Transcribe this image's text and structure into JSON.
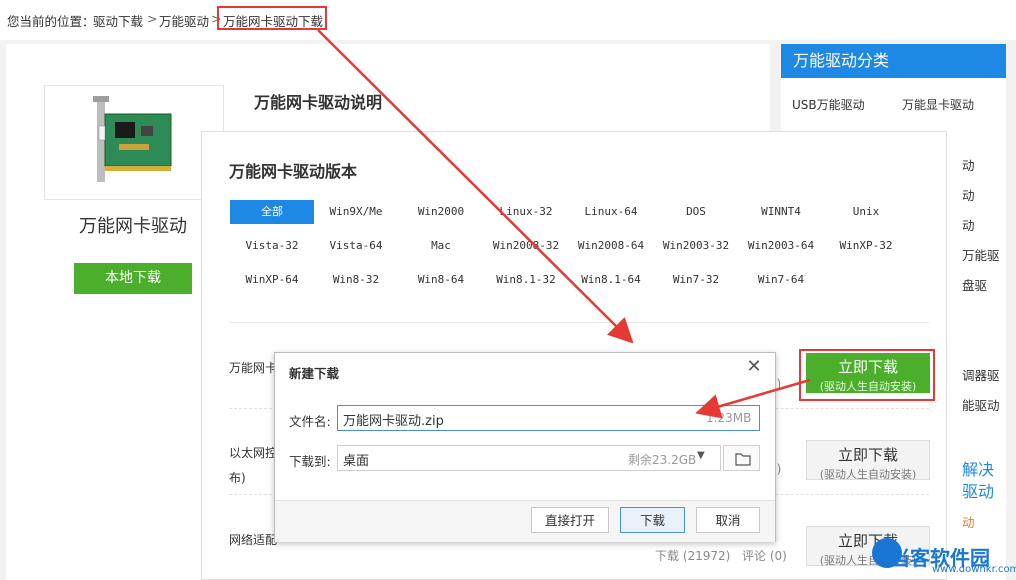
{
  "breadcrumb": {
    "prefix": "您当前的位置：",
    "items": [
      "驱动下载",
      "万能驱动",
      "万能网卡驱动下载"
    ],
    "sep": ">"
  },
  "product": {
    "title": "万能网卡驱动",
    "local_download": "本地下载",
    "desc_title": "万能网卡驱动说明"
  },
  "sidebar": {
    "header": "万能驱动分类",
    "items": [
      "USB万能驱动",
      "万能显卡驱动"
    ],
    "cut_items": [
      "动",
      "动",
      "动",
      "万能驱",
      "盘驱",
      "调器驱",
      "能驱动",
      "解决",
      "驱动",
      "动"
    ]
  },
  "versions": {
    "title": "万能网卡驱动版本",
    "items": [
      "全部",
      "Win9X/Me",
      "Win2000",
      "Linux-32",
      "Linux-64",
      "DOS",
      "WINNT4",
      "Unix",
      "Vista-32",
      "Vista-64",
      "Mac",
      "Win2008-32",
      "Win2008-64",
      "Win2003-32",
      "Win2003-64",
      "WinXP-32",
      "WinXP-64",
      "Win8-32",
      "Win8-64",
      "Win8.1-32",
      "Win8.1-64",
      "Win7-32",
      "Win7-64"
    ],
    "active": "全部"
  },
  "downloads": [
    {
      "name_partial": "万能网卡",
      "btn_main": "立即下载",
      "btn_sub": "(驱动人生自动安装)",
      "meta_tail": "0)"
    },
    {
      "name_partial": "以太网控",
      "name_line2": "布)",
      "btn_main": "立即下载",
      "btn_sub": "(驱动人生自动安装)",
      "meta_tail": "0)"
    },
    {
      "name_partial": "网络适配",
      "btn_main": "立即下载",
      "btn_sub": "(驱动人生自动安装)",
      "downloads": "下载 (21972)",
      "comments": "评论 (0)"
    }
  ],
  "dialog": {
    "title": "新建下载",
    "filename_label": "文件名:",
    "filename": "万能网卡驱动.zip",
    "size": "1.23MB",
    "saveto_label": "下载到:",
    "saveto": "桌面",
    "free_space": "剩余23.2GB",
    "open_btn": "直接打开",
    "download_btn": "下载",
    "cancel_btn": "取消"
  },
  "watermark": {
    "text": "当客软件园",
    "url": "www.downkr.com"
  },
  "colors": {
    "accent_blue": "#1e88e5",
    "green": "#4caf2c",
    "highlight_red": "#e53935"
  }
}
